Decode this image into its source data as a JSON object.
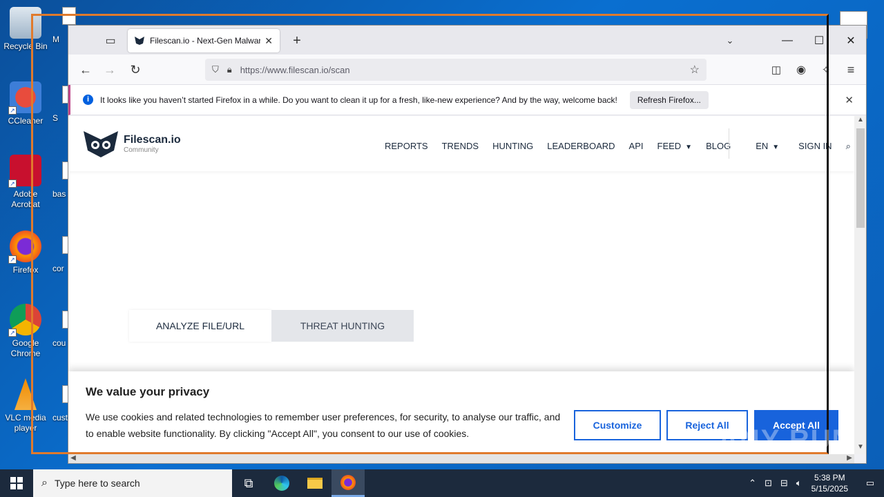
{
  "desktop": {
    "icons": [
      {
        "label": "Recycle Bin"
      },
      {
        "label": "CCleaner"
      },
      {
        "label": "Adobe Acrobat"
      },
      {
        "label": "Firefox"
      },
      {
        "label": "Google Chrome"
      },
      {
        "label": "VLC media player"
      }
    ],
    "partial_icons": [
      "M",
      "S",
      "bas",
      "cor",
      "cou",
      "cust"
    ]
  },
  "browser": {
    "tab_title": "Filescan.io - Next-Gen Malware",
    "url": "https://www.filescan.io/scan",
    "notification": {
      "message": "It looks like you haven’t started Firefox in a while. Do you want to clean it up for a fresh, like-new experience? And by the way, welcome back!",
      "button": "Refresh Firefox..."
    }
  },
  "site": {
    "logo_name": "Filescan.io",
    "logo_sub": "Community",
    "menu": [
      "REPORTS",
      "TRENDS",
      "HUNTING",
      "LEADERBOARD",
      "API",
      "FEED",
      "BLOG",
      "EN",
      "SIGN IN"
    ],
    "tabs": [
      "ANALYZE FILE/URL",
      "THREAT HUNTING"
    ]
  },
  "cookie": {
    "title": "We value your privacy",
    "text": "We use cookies and related technologies to remember user preferences, for security, to analyse our traffic, and to enable website functionality. By clicking \"Accept All\", you consent to our use of cookies.",
    "customize": "Customize",
    "reject": "Reject All",
    "accept": "Accept All"
  },
  "watermark": "ANY RUN",
  "taskbar": {
    "search_placeholder": "Type here to search",
    "time": "5:38 PM",
    "date": "5/15/2025"
  },
  "colors": {
    "accent": "#1863dc",
    "frame": "#e07a2c",
    "taskbar": "#1c2a3d"
  }
}
